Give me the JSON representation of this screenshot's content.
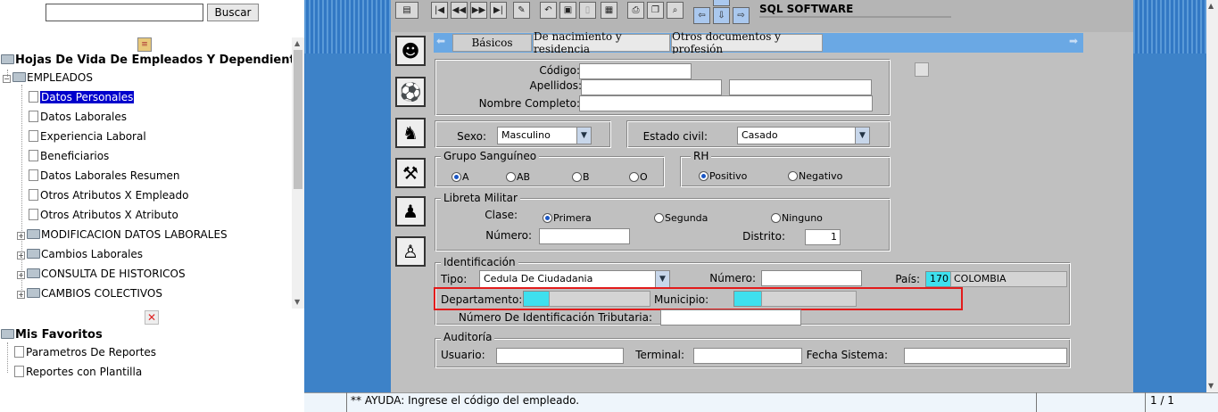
{
  "search": {
    "placeholder": "",
    "button": "Buscar"
  },
  "tree": {
    "root": "Hojas De Vida De Empleados Y Dependientes",
    "empleados": "EMPLEADOS",
    "items": [
      "Datos Personales",
      "Datos Laborales",
      "Experiencia Laboral",
      "Beneficiarios",
      "Datos Laborales Resumen",
      "Otros Atributos X Empleado",
      "Otros Atributos X Atributo"
    ],
    "groups": [
      "MODIFICACION DATOS LABORALES",
      "Cambios Laborales",
      "CONSULTA DE HISTORICOS",
      "CAMBIOS COLECTIVOS"
    ]
  },
  "favorites": {
    "title": "Mis Favoritos",
    "items": [
      "Parametros De Reportes",
      "Reportes con Plantilla"
    ],
    "remove_glyph": "✕"
  },
  "toolbar": {
    "app_name": "SQL SOFTWARE",
    "accent": "#3d82c8"
  },
  "tabs": [
    "Básicos",
    "De nacimiento y residencia",
    "Otros documentos y profesión"
  ],
  "form": {
    "codigo_label": "Código:",
    "apellidos_label": "Apellidos:",
    "nombre_label": "Nombre Completo:",
    "sexo_label": "Sexo:",
    "sexo_value": "Masculino",
    "estado_label": "Estado civil:",
    "estado_value": "Casado",
    "grupo_legend": "Grupo Sanguíneo",
    "grupo_options": [
      "A",
      "AB",
      "B",
      "O"
    ],
    "rh_legend": "RH",
    "rh_options": [
      "Positivo",
      "Negativo"
    ],
    "libreta_legend": "Libreta Militar",
    "clase_label": "Clase:",
    "clase_options": [
      "Primera",
      "Segunda",
      "Ninguno"
    ],
    "numero_label": "Número:",
    "distrito_label": "Distrito:",
    "distrito_value": "1",
    "ident_legend": "Identificación",
    "tipo_label": "Tipo:",
    "tipo_value": "Cedula De Ciudadania",
    "ident_numero_label": "Número:",
    "pais_label": "País:",
    "pais_code": "170",
    "pais_name": "COLOMBIA",
    "depto_label": "Departamento:",
    "municipio_label": "Municipio:",
    "nit_label": "Número De Identificación Tributaria:",
    "auditoria_legend": "Auditoría",
    "usuario_label": "Usuario:",
    "terminal_label": "Terminal:",
    "fecha_label": "Fecha Sistema:"
  },
  "status": {
    "help": "** AYUDA: Ingrese el código del empleado.",
    "page": "1 / 1"
  }
}
